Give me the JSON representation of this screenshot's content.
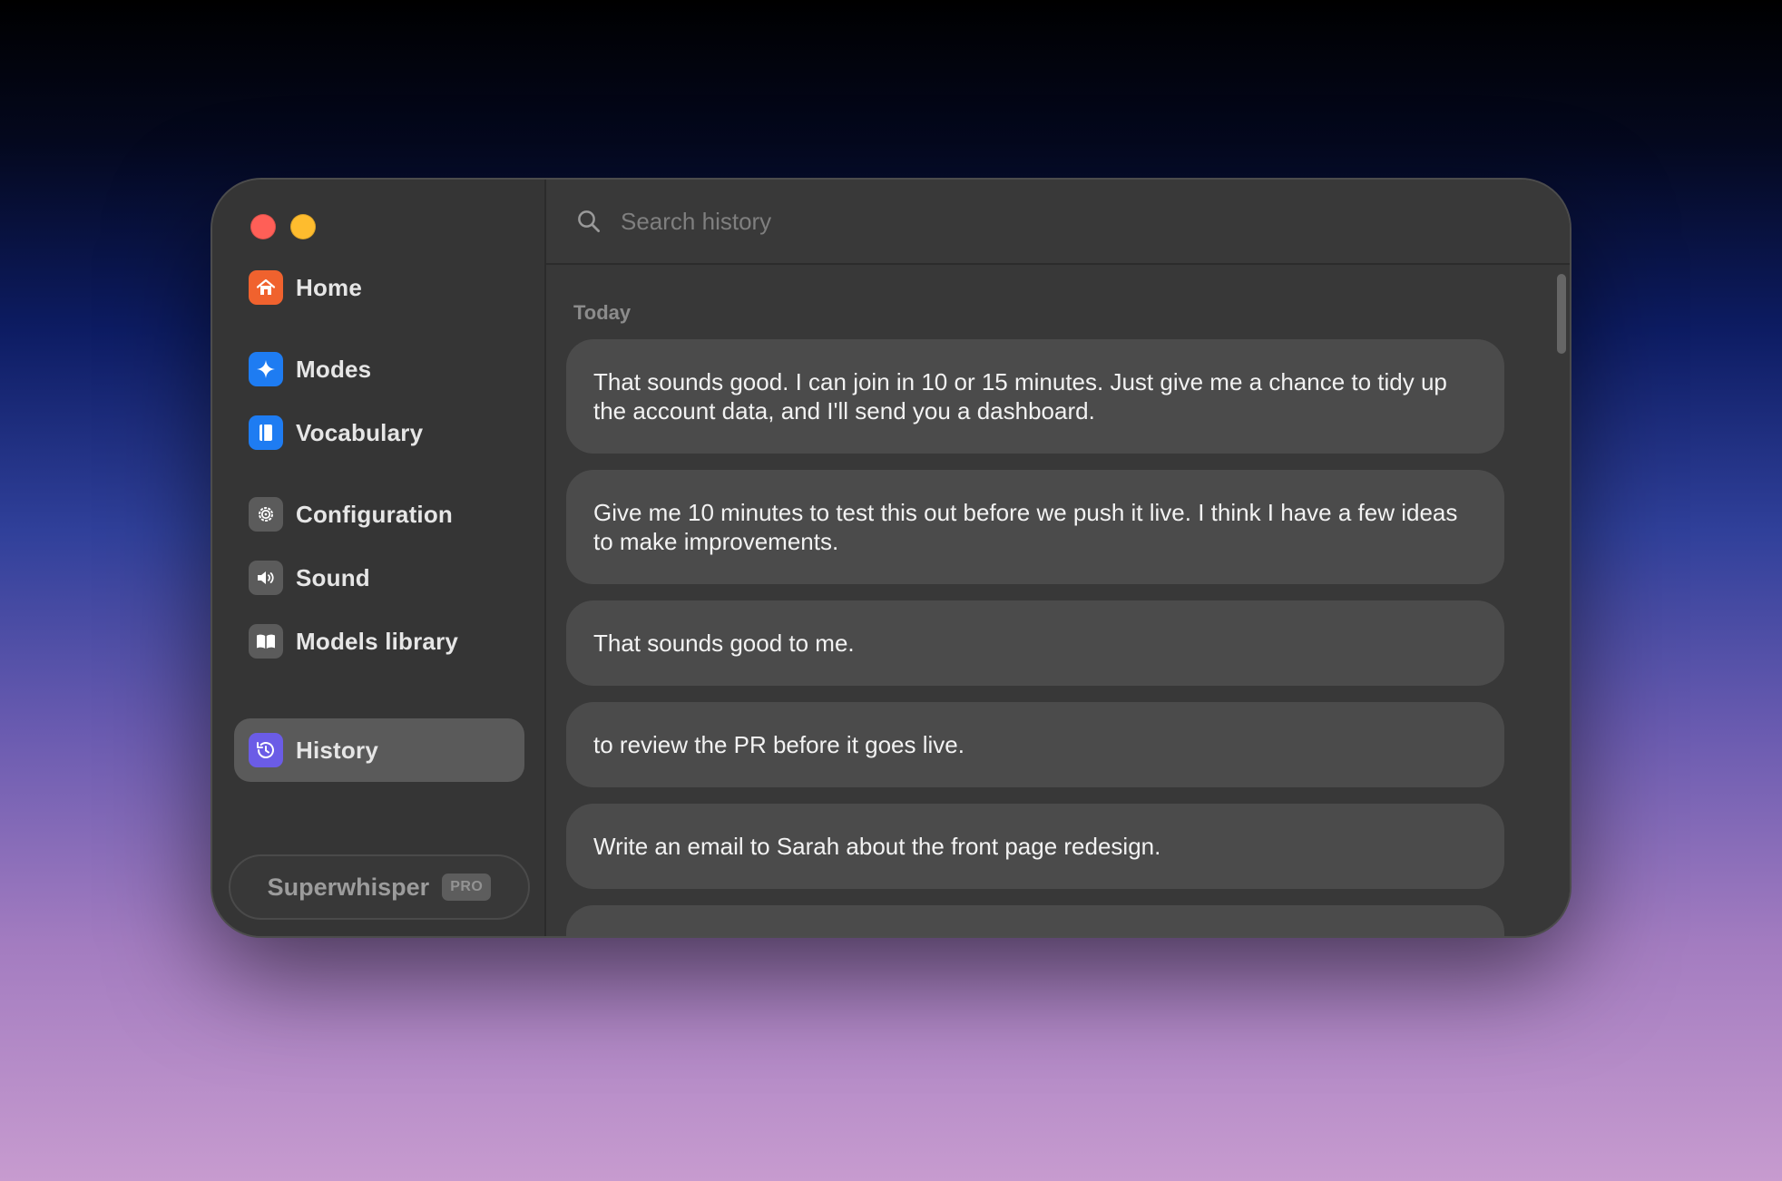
{
  "window": {
    "controls": [
      "close",
      "minimize"
    ]
  },
  "sidebar": {
    "items": [
      {
        "label": "Home",
        "icon": "house-icon",
        "color": "#f0622e",
        "active": false
      },
      {
        "label": "Modes",
        "icon": "sparkle-icon",
        "color": "#1e7cf2",
        "active": false
      },
      {
        "label": "Vocabulary",
        "icon": "book-icon",
        "color": "#1e7cf2",
        "active": false
      },
      {
        "label": "Configuration",
        "icon": "gear-icon",
        "color": "#5b5b5b",
        "active": false
      },
      {
        "label": "Sound",
        "icon": "speaker-icon",
        "color": "#5b5b5b",
        "active": false
      },
      {
        "label": "Models library",
        "icon": "open-book-icon",
        "color": "#5b5b5b",
        "active": false
      },
      {
        "label": "History",
        "icon": "history-icon",
        "color": "#6b5ce6",
        "active": true
      }
    ],
    "pro": {
      "name": "Superwhisper",
      "badge": "PRO"
    }
  },
  "search": {
    "placeholder": "Search history",
    "value": ""
  },
  "history": {
    "section": "Today",
    "entries": [
      "That sounds good. I can join in 10 or 15 minutes. Just give me a chance to tidy up the account data, and I'll send you a dashboard.",
      "Give me 10 minutes to test this out before we push it live. I think I have a few ideas to make improvements.",
      "That sounds good to me.",
      "to review the PR before it goes live.",
      "Write an email to Sarah about the front page redesign.",
      ""
    ]
  }
}
